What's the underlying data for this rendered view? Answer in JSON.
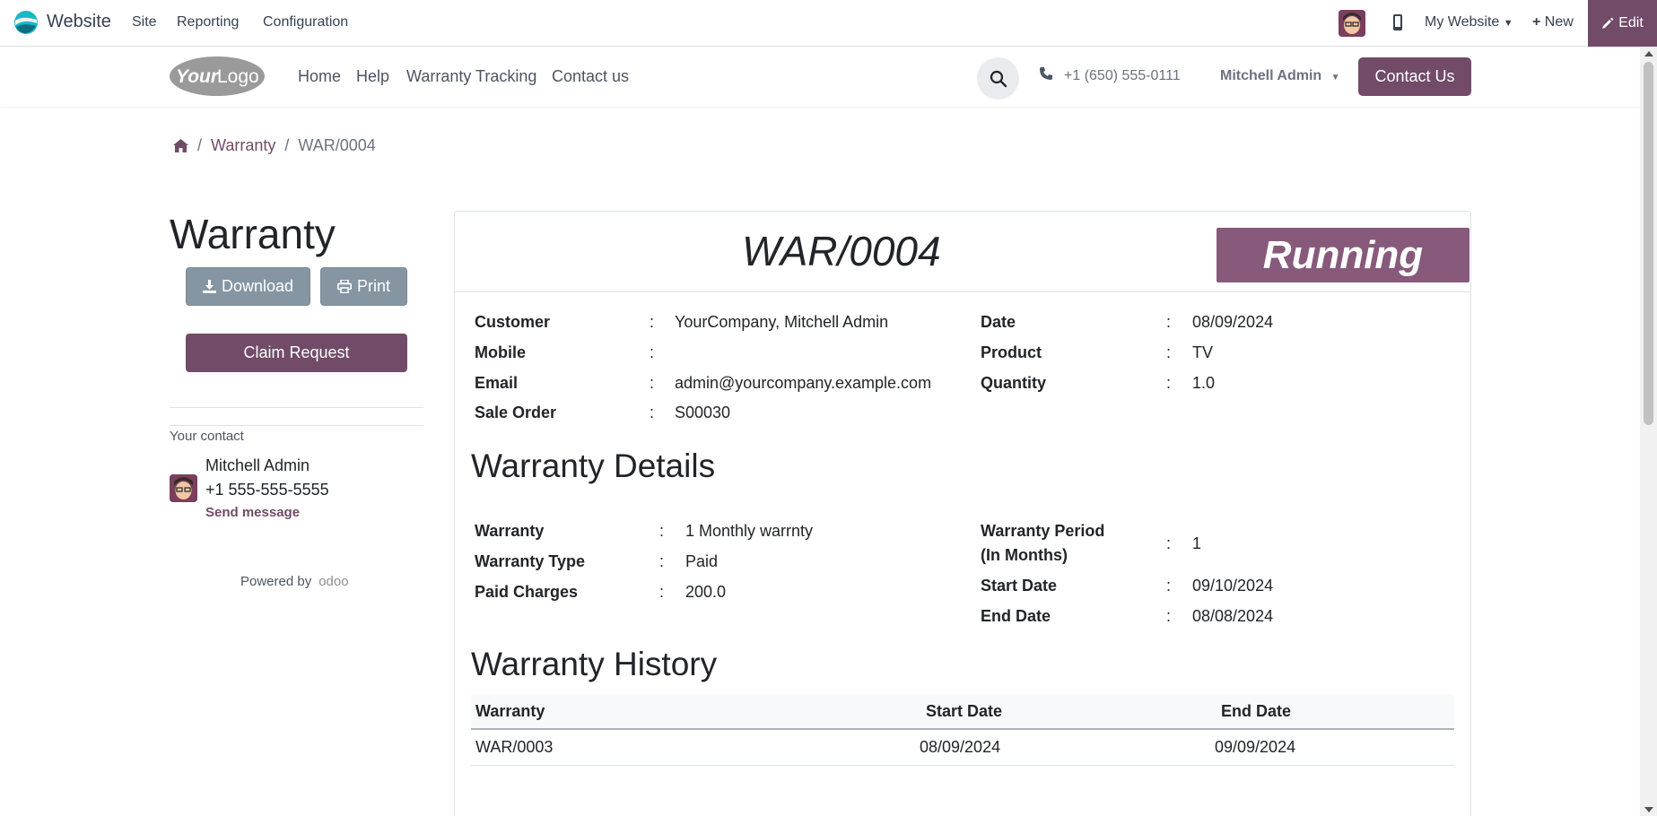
{
  "admin_bar": {
    "app_name": "Website",
    "menus": [
      "Site",
      "Reporting",
      "Configuration"
    ],
    "my_website": "My Website",
    "new_label": "New",
    "edit_label": "Edit"
  },
  "header": {
    "logo_text_your": "Your",
    "logo_text_logo": "Logo",
    "nav": [
      "Home",
      "Help",
      "Warranty Tracking",
      "Contact us"
    ],
    "phone": "+1 (650) 555-0111",
    "user": "Mitchell Admin",
    "contact_button": "Contact Us"
  },
  "breadcrumb": {
    "sep": "/",
    "parent": "Warranty",
    "current": "WAR/0004"
  },
  "sidebar": {
    "title": "Warranty",
    "download": "Download",
    "print": "Print",
    "claim": "Claim Request",
    "your_contact": "Your contact",
    "contact_name": "Mitchell Admin",
    "contact_phone": "+1 555-555-5555",
    "send_message": "Send message",
    "powered_by": "Powered by",
    "odoo": "odoo"
  },
  "card": {
    "reference": "WAR/0004",
    "status": "Running",
    "colon": ":",
    "left_fields": [
      {
        "label": "Customer",
        "value": "YourCompany, Mitchell Admin"
      },
      {
        "label": "Mobile",
        "value": ""
      },
      {
        "label": "Email",
        "value": "admin@yourcompany.example.com"
      },
      {
        "label": "Sale Order",
        "value": "S00030"
      }
    ],
    "right_fields": [
      {
        "label": "Date",
        "value": "08/09/2024"
      },
      {
        "label": "Product",
        "value": "TV"
      },
      {
        "label": "Quantity",
        "value": "1.0"
      }
    ],
    "details_title": "Warranty Details",
    "details_left": [
      {
        "label": "Warranty",
        "value": "1 Monthly warrnty"
      },
      {
        "label": "Warranty Type",
        "value": "Paid"
      },
      {
        "label": "Paid Charges",
        "value": "200.0"
      }
    ],
    "details_right": [
      {
        "label_line1": "Warranty Period",
        "label_line2": "(In Months)",
        "value": "1"
      },
      {
        "label": "Start Date",
        "value": "09/10/2024"
      },
      {
        "label": "End Date",
        "value": "08/08/2024"
      }
    ],
    "history_title": "Warranty History",
    "history_columns": [
      "Warranty",
      "Start Date",
      "End Date"
    ],
    "history_rows": [
      [
        "WAR/0003",
        "08/09/2024",
        "09/09/2024"
      ]
    ]
  },
  "colors": {
    "brand": "#714b67",
    "status_bg": "#875a7b",
    "button_grey": "#8595a2"
  }
}
